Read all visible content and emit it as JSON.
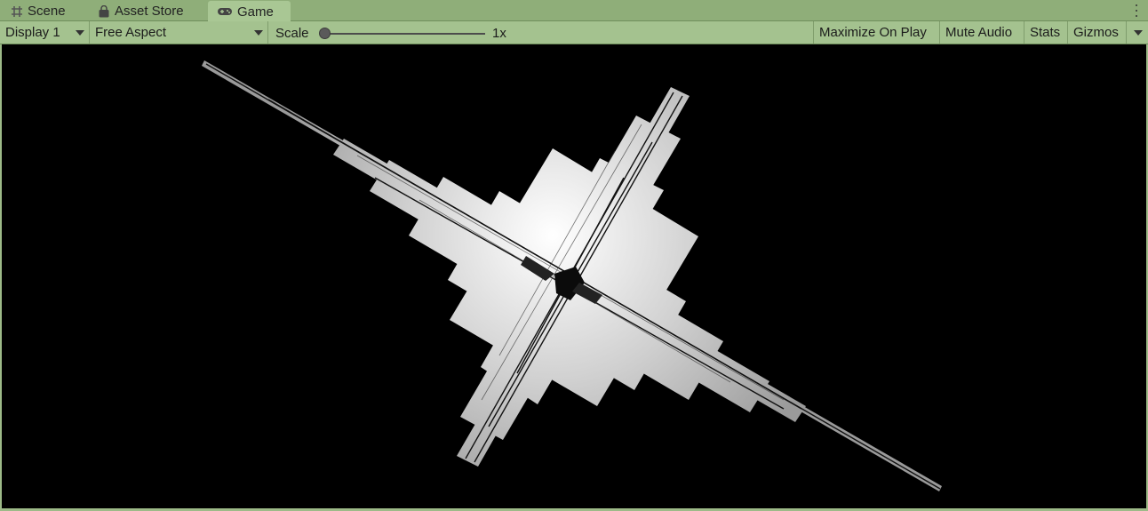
{
  "tabs": [
    {
      "label": "Scene",
      "icon": "grid-icon",
      "active": false
    },
    {
      "label": "Asset Store",
      "icon": "bag-icon",
      "active": false
    },
    {
      "label": "Game",
      "icon": "gamepad-icon",
      "active": true
    }
  ],
  "toolbar": {
    "display": "Display 1",
    "aspect": "Free Aspect",
    "scale_label": "Scale",
    "scale_value": "1x",
    "maximize": "Maximize On Play",
    "mute": "Mute Audio",
    "stats": "Stats",
    "gizmos": "Gizmos"
  },
  "colors": {
    "tab_strip": "#8fae79",
    "toolbar": "#a4c28f",
    "active_tab": "#a9c794",
    "viewport_bg": "#000000"
  }
}
